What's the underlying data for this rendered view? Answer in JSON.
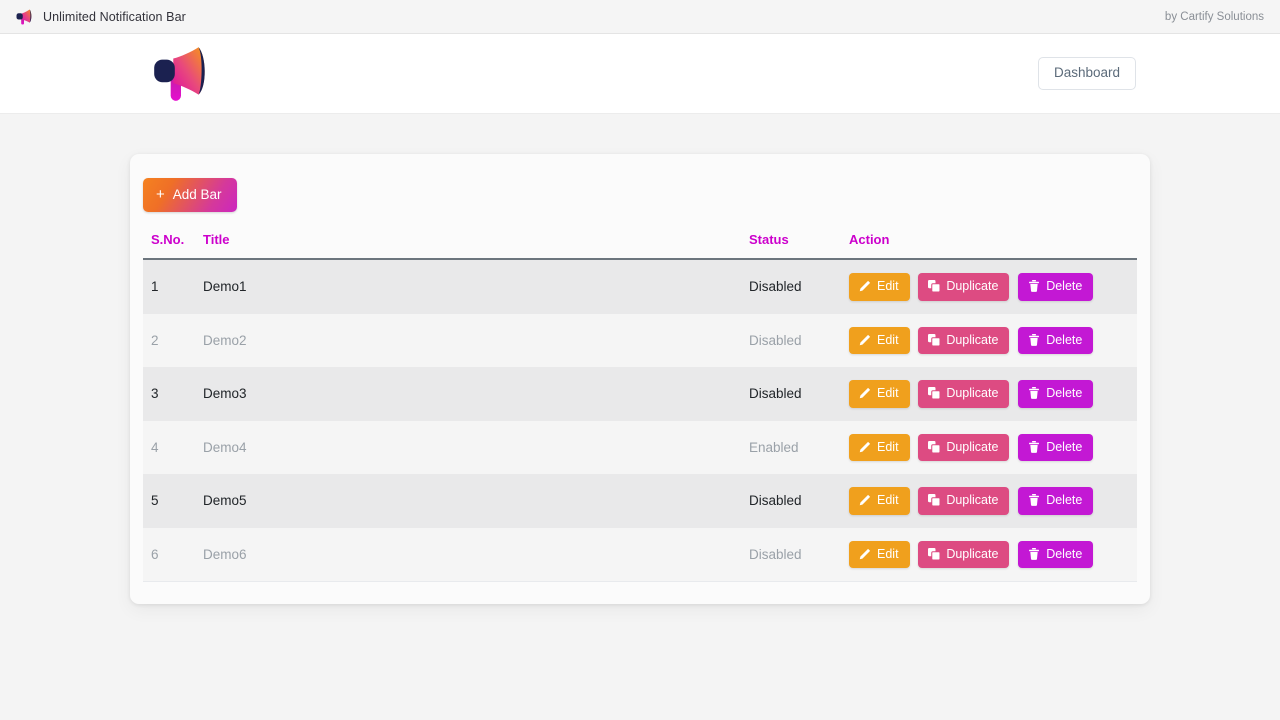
{
  "titlebar": {
    "icon": "megaphone-icon",
    "title": "Unlimited Notification Bar",
    "credit": "by Cartify Solutions"
  },
  "navbar": {
    "logo_icon": "megaphone-logo-icon",
    "dashboard_label": "Dashboard"
  },
  "toolbar": {
    "add_bar_label": "Add Bar",
    "add_bar_plus": "+"
  },
  "table": {
    "headers": {
      "sno": "S.No.",
      "title": "Title",
      "status": "Status",
      "action": "Action"
    },
    "actions": {
      "edit_label": "Edit",
      "duplicate_label": "Duplicate",
      "delete_label": "Delete",
      "edit_icon": "pencil-icon",
      "duplicate_icon": "copy-icon",
      "delete_icon": "trash-icon"
    },
    "rows": [
      {
        "sno": "1",
        "title": "Demo1",
        "status": "Disabled"
      },
      {
        "sno": "2",
        "title": "Demo2",
        "status": "Disabled"
      },
      {
        "sno": "3",
        "title": "Demo3",
        "status": "Disabled"
      },
      {
        "sno": "4",
        "title": "Demo4",
        "status": "Enabled"
      },
      {
        "sno": "5",
        "title": "Demo5",
        "status": "Disabled"
      },
      {
        "sno": "6",
        "title": "Demo6",
        "status": "Disabled"
      }
    ]
  },
  "colors": {
    "accent_magenta": "#cc00cc",
    "btn_edit": "#f0a01d",
    "btn_duplicate": "#dd4b82",
    "btn_delete": "#c318d4",
    "gradient_start": "#f58220",
    "gradient_end": "#cc26c0",
    "page_bg": "#f4f4f4",
    "card_bg": "#fbfbfb",
    "row_odd_bg": "#e9e9ea",
    "row_even_bg": "#f5f5f5",
    "header_rule": "#6c757d"
  }
}
